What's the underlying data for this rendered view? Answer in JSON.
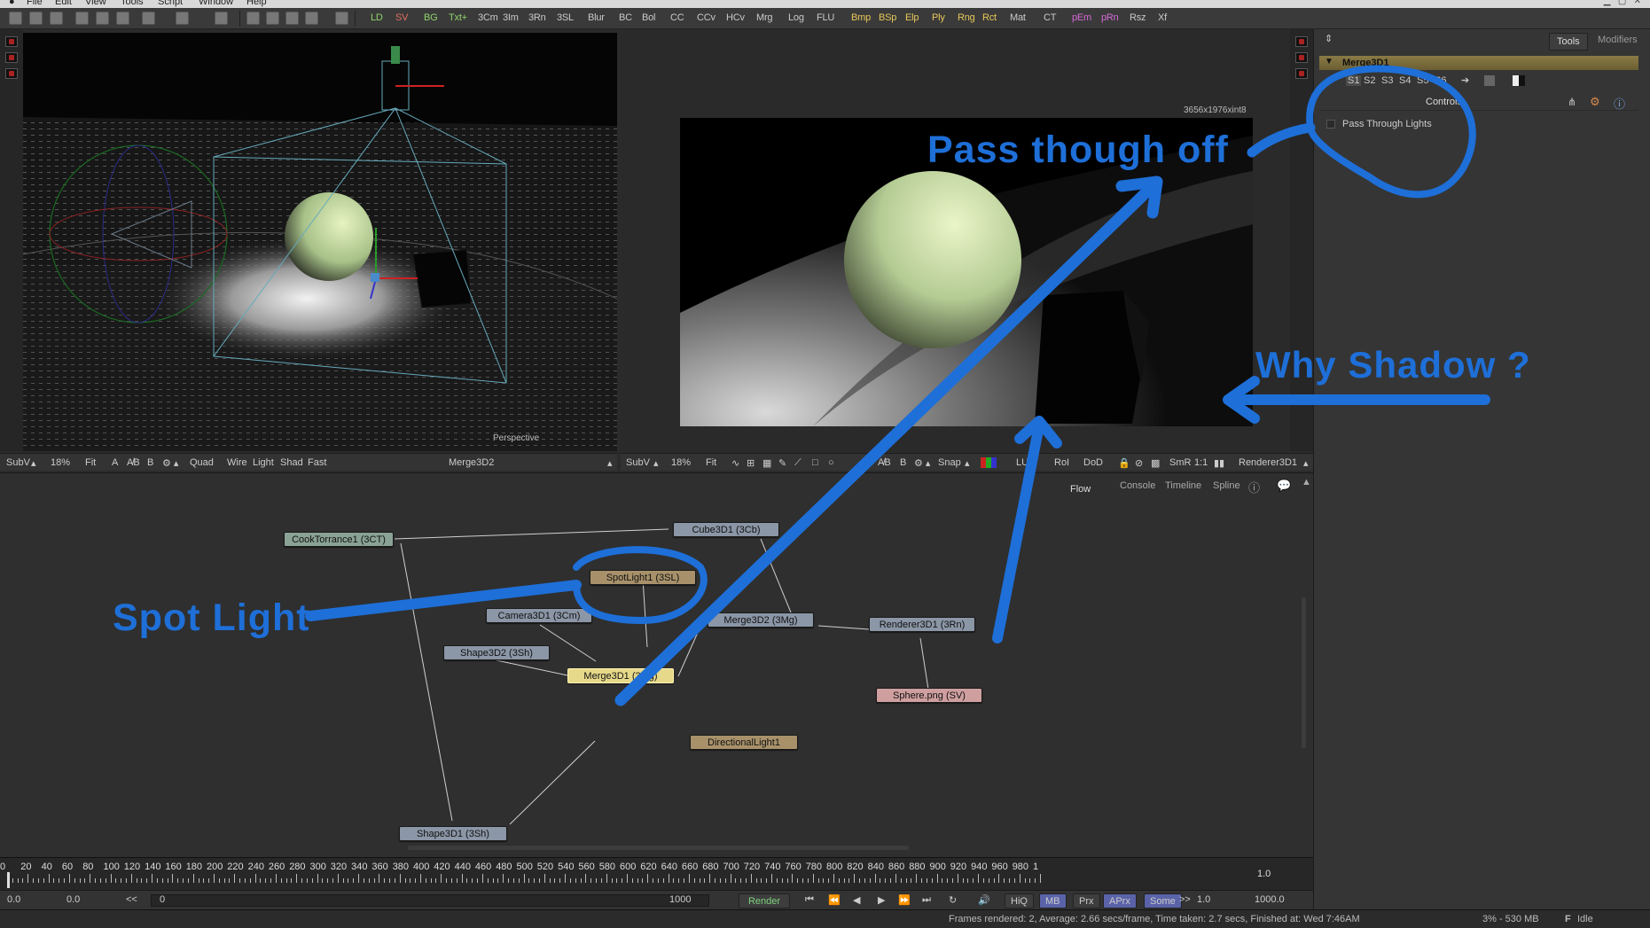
{
  "menubar": {
    "items": [
      "File",
      "Edit",
      "View",
      "Tools",
      "Script",
      "Window",
      "Help"
    ]
  },
  "toolbar": {
    "buttons": [
      {
        "label": "LD",
        "color": "#8fd36a"
      },
      {
        "label": "SV",
        "color": "#e07060"
      },
      {
        "label": "BG",
        "color": "#8fd36a"
      },
      {
        "label": "Txt+",
        "color": "#8fd36a"
      },
      {
        "label": "3Cm",
        "color": "#c9c9c9"
      },
      {
        "label": "3Im",
        "color": "#c9c9c9"
      },
      {
        "label": "3Rn",
        "color": "#c9c9c9"
      },
      {
        "label": "3SL",
        "color": "#c9c9c9"
      },
      {
        "label": "Blur",
        "color": "#c9c9c9"
      },
      {
        "label": "BC",
        "color": "#c9c9c9"
      },
      {
        "label": "Bol",
        "color": "#c9c9c9"
      },
      {
        "label": "CC",
        "color": "#c9c9c9"
      },
      {
        "label": "CCv",
        "color": "#c9c9c9"
      },
      {
        "label": "HCv",
        "color": "#c9c9c9"
      },
      {
        "label": "Mrg",
        "color": "#c9c9c9"
      },
      {
        "label": "Log",
        "color": "#c9c9c9"
      },
      {
        "label": "FLU",
        "color": "#c9c9c9"
      },
      {
        "label": "Bmp",
        "color": "#e8c85a"
      },
      {
        "label": "BSp",
        "color": "#e8c85a"
      },
      {
        "label": "Elp",
        "color": "#e8c85a"
      },
      {
        "label": "Ply",
        "color": "#e8c85a"
      },
      {
        "label": "Rng",
        "color": "#e8c85a"
      },
      {
        "label": "Rct",
        "color": "#e8c85a"
      },
      {
        "label": "Mat",
        "color": "#c9c9c9"
      },
      {
        "label": "CT",
        "color": "#c9c9c9"
      },
      {
        "label": "pEm",
        "color": "#d56ad5"
      },
      {
        "label": "pRn",
        "color": "#d56ad5"
      },
      {
        "label": "Rsz",
        "color": "#c9c9c9"
      },
      {
        "label": "Xf",
        "color": "#c9c9c9"
      }
    ]
  },
  "viewer_left": {
    "perspective_label": "Perspective",
    "bar": {
      "subv": "SubV",
      "zoom": "18%",
      "fit": "Fit",
      "btn_a": "A",
      "btn_ab": "A̸B",
      "btn_b": "B",
      "quad": "Quad",
      "wire": "Wire",
      "light": "Light",
      "shad": "Shad",
      "fast": "Fast",
      "node": "Merge3D2"
    }
  },
  "viewer_right": {
    "resolution": "3656x1976xint8",
    "bar": {
      "subv": "SubV",
      "zoom": "18%",
      "fit": "Fit",
      "snap": "Snap",
      "lut": "LUT",
      "roi": "RoI",
      "dod": "DoD",
      "smr": "SmR",
      "ratio": "1:1",
      "node": "Renderer3D1"
    }
  },
  "flow": {
    "tabs": {
      "flow": "Flow",
      "console": "Console",
      "timeline": "Timeline",
      "spline": "Spline"
    },
    "nodes": {
      "cooktorrance": "CookTorrance1 (3CT)",
      "cube": "Cube3D1 (3Cb)",
      "spotlight": "SpotLight1 (3SL)",
      "camera": "Camera3D1 (3Cm)",
      "merge2": "Merge3D2 (3Mg)",
      "renderer": "Renderer3D1 (3Rn)",
      "shape2": "Shape3D2 (3Sh)",
      "merge1": "Merge3D1 (3Mg)",
      "sphere": "Sphere.png (SV)",
      "directional": "DirectionalLight1",
      "shape1": "Shape3D1 (3Sh)"
    }
  },
  "timeline": {
    "ticks": [
      "0",
      "20",
      "40",
      "60",
      "80",
      "100",
      "120",
      "140",
      "160",
      "180",
      "200",
      "220",
      "240",
      "260",
      "280",
      "300",
      "320",
      "340",
      "360",
      "380",
      "400",
      "420",
      "440",
      "460",
      "480",
      "500",
      "520",
      "540",
      "560",
      "580",
      "600",
      "620",
      "640",
      "660",
      "680",
      "700",
      "720",
      "740",
      "760",
      "780",
      "800",
      "820",
      "840",
      "860",
      "880",
      "900",
      "920",
      "940",
      "960",
      "980",
      "1"
    ],
    "end_value": "1.0"
  },
  "transport": {
    "start": "0.0",
    "current": "0.0",
    "prev_label": "<<",
    "frame": "0",
    "end": "1000",
    "render": "Render",
    "hiq": "HiQ",
    "mb": "MB",
    "prx": "Prx",
    "aprx": "APrx",
    "some": "Some",
    "next_label": ">>",
    "step": "1.0",
    "global_end": "1000.0"
  },
  "status": {
    "message": "Frames rendered: 2,  Average: 2.66 secs/frame,  Time taken: 2.7 secs,  Finished at: Wed 7:46AM",
    "memory": "3% - 530 MB",
    "state": "Idle"
  },
  "side": {
    "tab_tools": "Tools",
    "tab_modifiers": "Modifiers",
    "node_title": "Merge3D1",
    "slots": [
      "S1",
      "S2",
      "S3",
      "S4",
      "S5",
      "S6"
    ],
    "controls": "Controls",
    "pass_through": "Pass Through Lights"
  },
  "annotations": {
    "pass_off": "Pass  though  off",
    "why_shadow": "Why  Shadow  ?",
    "spot_light": "Spot  Light",
    "color": "#1e6fd8"
  }
}
